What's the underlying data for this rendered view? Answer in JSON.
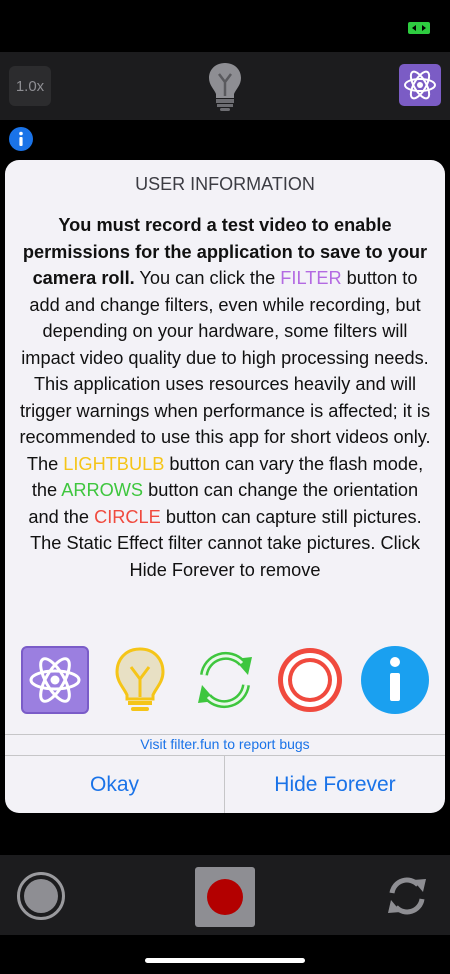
{
  "top_toolbar": {
    "zoom_label": "1.0x"
  },
  "dialog": {
    "title": "USER INFORMATION",
    "message": {
      "bold_intro": "You must record a test video to enable permissions for the application to save to your camera roll.",
      "part1": " You can click the ",
      "filter_word": "FILTER",
      "part2": " button to add and change filters, even while recording, but depending on your hardware, some filters will impact video quality due to high processing needs. This application uses resources heavily and will trigger warnings when performance is affected; it is recommended to use this app for short videos only. The ",
      "lightbulb_word": "LIGHTBULB",
      "part3": " button can vary the flash mode, the ",
      "arrows_word": "ARROWS",
      "part4": " button can change the orientation and the ",
      "circle_word": "CIRCLE",
      "part5": " button can capture still pictures. The Static Effect filter cannot take pictures. Click Hide Forever to remove"
    },
    "legend_icons": [
      "atom-filter-icon",
      "lightbulb-icon",
      "rotate-arrows-icon",
      "circle-capture-icon",
      "info-icon"
    ],
    "bugs_link": "Visit filter.fun to report bugs",
    "okay_label": "Okay",
    "hide_forever_label": "Hide Forever"
  },
  "colors": {
    "filter": "#b36ae2",
    "lightbulb": "#f5c518",
    "arrows": "#3ec63e",
    "circle": "#f04a3e",
    "link": "#1a73e8",
    "record": "#b30000"
  }
}
